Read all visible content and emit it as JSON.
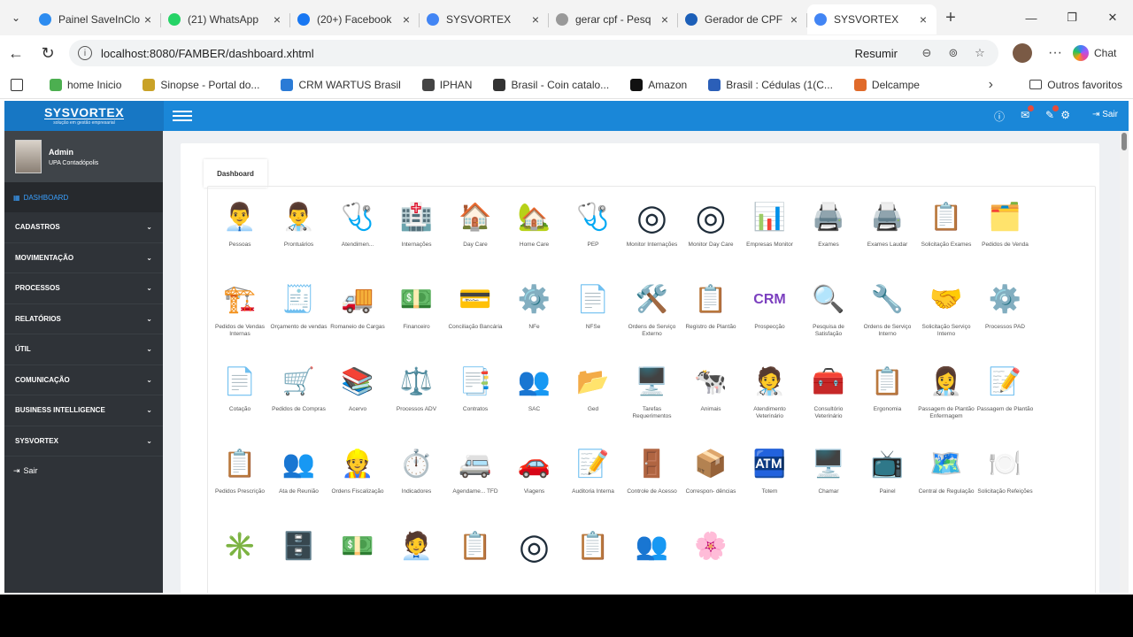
{
  "browser": {
    "tabs": [
      {
        "title": "Painel SaveInClo",
        "color": "#2d8cf0"
      },
      {
        "title": "(21) WhatsApp",
        "color": "#25d366"
      },
      {
        "title": "(20+) Facebook",
        "color": "#1877f2"
      },
      {
        "title": "SYSVORTEX",
        "color": "#4285f4"
      },
      {
        "title": "gerar cpf - Pesq",
        "color": "#999999"
      },
      {
        "title": "Gerador de CPF",
        "color": "#1c5fb8"
      },
      {
        "title": "SYSVORTEX",
        "color": "#4285f4",
        "active": true
      }
    ],
    "url": "localhost:8080/FAMBER/dashboard.xhtml",
    "resumir": "Resumir",
    "chat": "Chat",
    "bookmarks": [
      {
        "label": "home Inicio",
        "color": "#4caf50"
      },
      {
        "label": "Sinopse - Portal do...",
        "color": "#c9a227"
      },
      {
        "label": "CRM WARTUS Brasil",
        "color": "#2b7bd6"
      },
      {
        "label": "IPHAN",
        "color": "#444444"
      },
      {
        "label": "Brasil - Coin catalo...",
        "color": "#333333"
      },
      {
        "label": "Amazon",
        "color": "#111111"
      },
      {
        "label": "Brasil : Cédulas (1(C...",
        "color": "#2b5fb8"
      },
      {
        "label": "Delcampe",
        "color": "#e06a2a"
      }
    ],
    "other_favorites": "Outros favoritos"
  },
  "app": {
    "logo": "SYSVORTEX",
    "logo_sub": "solução em gestão empresarial",
    "logout": "Sair",
    "user": {
      "name": "Admin",
      "org": "UPA Contadópolis"
    },
    "dashboard_link": "DASHBOARD",
    "menu": [
      "CADASTROS",
      "MOVIMENTAÇÃO",
      "PROCESSOS",
      "RELATÓRIOS",
      "ÚTIL",
      "COMUNICAÇÃO",
      "BUSINESS INTELLIGENCE",
      "SYSVORTEX"
    ],
    "sair": "Sair",
    "content_tab": "Dashboard",
    "tiles": [
      {
        "label": "Pessoas",
        "glyph": "👨‍💼",
        "bg": "#ffffff"
      },
      {
        "label": "Prontuários",
        "glyph": "👨‍⚕️",
        "bg": "#ffffff"
      },
      {
        "label": "Atendimen...",
        "glyph": "🩺",
        "bg": "#ffffff"
      },
      {
        "label": "Internações",
        "glyph": "🏥",
        "bg": "#ffffff"
      },
      {
        "label": "Day Care",
        "glyph": "🏠",
        "bg": "#ffffff"
      },
      {
        "label": "Home Care",
        "glyph": "🏡",
        "bg": "#ffffff"
      },
      {
        "label": "PEP",
        "glyph": "🩺",
        "bg": "#ffffff"
      },
      {
        "label": "Monitor Internações",
        "glyph": "◎",
        "bg": "#ffffff"
      },
      {
        "label": "Monitor Day Care",
        "glyph": "◎",
        "bg": "#ffffff"
      },
      {
        "label": "Empresas Monitor",
        "glyph": "📊",
        "bg": "#ffffff"
      },
      {
        "label": "Exames",
        "glyph": "🖨️",
        "bg": "#ffffff"
      },
      {
        "label": "Exames Laudar",
        "glyph": "🖨️",
        "bg": "#ffffff"
      },
      {
        "label": "Solicitação Exames",
        "glyph": "📋",
        "bg": "#ffffff"
      },
      {
        "label": "Pedidos de Venda",
        "glyph": "🗂️",
        "bg": "#ffffff"
      },
      {
        "label": "Pedidos de Vendas Internas",
        "glyph": "🏗️",
        "bg": "#ffffff"
      },
      {
        "label": "Orçamento de vendas",
        "glyph": "🧾",
        "bg": "#ffffff"
      },
      {
        "label": "Romaneio de Cargas",
        "glyph": "🚚",
        "bg": "#ffffff"
      },
      {
        "label": "Financeiro",
        "glyph": "💵",
        "bg": "#ffffff"
      },
      {
        "label": "Conciliação Bancária",
        "glyph": "💳",
        "bg": "#ffffff"
      },
      {
        "label": "NFe",
        "glyph": "⚙️",
        "bg": "#ffffff"
      },
      {
        "label": "NFSe",
        "glyph": "📄",
        "bg": "#ffffff"
      },
      {
        "label": "Ordens de Serviço Externo",
        "glyph": "🛠️",
        "bg": "#ffffff"
      },
      {
        "label": "Registro de Plantão",
        "glyph": "📋",
        "bg": "#ffffff"
      },
      {
        "label": "Prospecção",
        "glyph": "CRM",
        "bg": "#ffffff"
      },
      {
        "label": "Pesquisa de Satisfação",
        "glyph": "🔍",
        "bg": "#ffffff"
      },
      {
        "label": "Ordens de Serviço Interno",
        "glyph": "🔧",
        "bg": "#ffffff"
      },
      {
        "label": "Solicitação Serviço Interno",
        "glyph": "🤝",
        "bg": "#ffffff"
      },
      {
        "label": "Processos PAD",
        "glyph": "⚙️",
        "bg": "#ffffff"
      },
      {
        "label": "Cotação",
        "glyph": "📄",
        "bg": "#ffffff"
      },
      {
        "label": "Pedidos de Compras",
        "glyph": "🛒",
        "bg": "#ffffff"
      },
      {
        "label": "Acervo",
        "glyph": "📚",
        "bg": "#ffffff"
      },
      {
        "label": "Processos ADV",
        "glyph": "⚖️",
        "bg": "#ffffff"
      },
      {
        "label": "Contratos",
        "glyph": "📑",
        "bg": "#ffffff"
      },
      {
        "label": "SAC",
        "glyph": "👥",
        "bg": "#ffffff"
      },
      {
        "label": "Ged",
        "glyph": "📂",
        "bg": "#ffffff"
      },
      {
        "label": "Tarefas Requerimentos",
        "glyph": "🖥️",
        "bg": "#ffffff"
      },
      {
        "label": "Animais",
        "glyph": "🐄",
        "bg": "#ffffff"
      },
      {
        "label": "Atendimento Veterinário",
        "glyph": "🧑‍⚕️",
        "bg": "#ffffff"
      },
      {
        "label": "Consultório Veterinário",
        "glyph": "🧰",
        "bg": "#ffffff"
      },
      {
        "label": "Ergonomia",
        "glyph": "📋",
        "bg": "#ffffff"
      },
      {
        "label": "Passagem de Plantão Enfermagem",
        "glyph": "👩‍⚕️",
        "bg": "#ffffff"
      },
      {
        "label": "Passagem de Plantão",
        "glyph": "📝",
        "bg": "#ffffff"
      },
      {
        "label": "Pedidos Prescrição",
        "glyph": "📋",
        "bg": "#ffffff"
      },
      {
        "label": "Ata de Reunião",
        "glyph": "👥",
        "bg": "#ffffff"
      },
      {
        "label": "Ordens Fiscalização",
        "glyph": "👷",
        "bg": "#ffffff"
      },
      {
        "label": "Indicadores",
        "glyph": "⏱️",
        "bg": "#ffffff"
      },
      {
        "label": "Agendame... TFD",
        "glyph": "🚐",
        "bg": "#ffffff"
      },
      {
        "label": "Viagens",
        "glyph": "🚗",
        "bg": "#ffffff"
      },
      {
        "label": "Auditoria Interna",
        "glyph": "📝",
        "bg": "#ffffff"
      },
      {
        "label": "Controle de Acesso",
        "glyph": "🚪",
        "bg": "#ffffff"
      },
      {
        "label": "Correspon- dências",
        "glyph": "📦",
        "bg": "#ffffff"
      },
      {
        "label": "Totem",
        "glyph": "🏧",
        "bg": "#ffffff"
      },
      {
        "label": "Chamar",
        "glyph": "🖥️",
        "bg": "#ffffff"
      },
      {
        "label": "Painel",
        "glyph": "📺",
        "bg": "#ffffff"
      },
      {
        "label": "Central de Regulação",
        "glyph": "🗺️",
        "bg": "#ffffff"
      },
      {
        "label": "Solicitação Refeições",
        "glyph": "🍽️",
        "bg": "#ffffff"
      },
      {
        "label": "",
        "glyph": "✳️",
        "bg": "#ffffff"
      },
      {
        "label": "",
        "glyph": "🗄️",
        "bg": "#ffffff"
      },
      {
        "label": "",
        "glyph": "💵",
        "bg": "#ffffff"
      },
      {
        "label": "",
        "glyph": "🧑‍💼",
        "bg": "#ffffff"
      },
      {
        "label": "",
        "glyph": "📋",
        "bg": "#ffffff"
      },
      {
        "label": "",
        "glyph": "◎",
        "bg": "#ffffff"
      },
      {
        "label": "",
        "glyph": "📋",
        "bg": "#ffffff"
      },
      {
        "label": "",
        "glyph": "👥",
        "bg": "#ffffff"
      },
      {
        "label": "",
        "glyph": "🌸",
        "bg": "#ffffff"
      }
    ]
  }
}
